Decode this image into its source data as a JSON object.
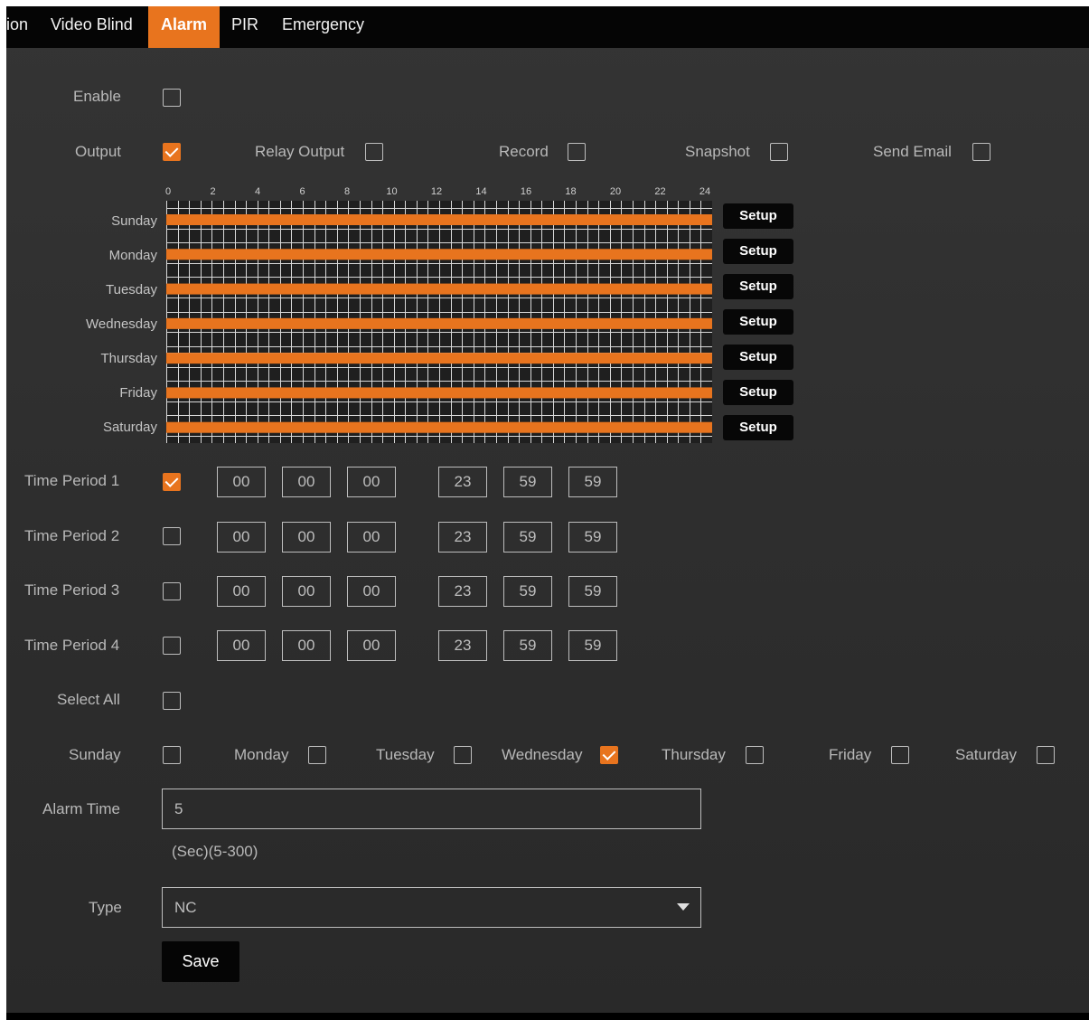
{
  "tabs": [
    "ion",
    "Video Blind",
    "Alarm",
    "PIR",
    "Emergency"
  ],
  "active_tab": "Alarm",
  "accent_color": "#e8741e",
  "enable": {
    "label": "Enable",
    "checked": false
  },
  "outputs": [
    {
      "label": "Output",
      "checked": true
    },
    {
      "label": "Relay Output",
      "checked": false
    },
    {
      "label": "Record",
      "checked": false
    },
    {
      "label": "Snapshot",
      "checked": false
    },
    {
      "label": "Send Email",
      "checked": false
    }
  ],
  "schedule": {
    "hour_labels": [
      "0",
      "2",
      "4",
      "6",
      "8",
      "10",
      "12",
      "14",
      "16",
      "18",
      "20",
      "22",
      "24"
    ],
    "days": [
      "Sunday",
      "Monday",
      "Tuesday",
      "Wednesday",
      "Thursday",
      "Friday",
      "Saturday"
    ],
    "setup_label": "Setup",
    "armed_ranges_hours": [
      [
        0,
        24
      ],
      [
        0,
        24
      ],
      [
        0,
        24
      ],
      [
        0,
        24
      ],
      [
        0,
        24
      ],
      [
        0,
        24
      ],
      [
        0,
        24
      ]
    ]
  },
  "time_periods": [
    {
      "label": "Time Period 1",
      "checked": true,
      "start": [
        "00",
        "00",
        "00"
      ],
      "end": [
        "23",
        "59",
        "59"
      ]
    },
    {
      "label": "Time Period 2",
      "checked": false,
      "start": [
        "00",
        "00",
        "00"
      ],
      "end": [
        "23",
        "59",
        "59"
      ]
    },
    {
      "label": "Time Period 3",
      "checked": false,
      "start": [
        "00",
        "00",
        "00"
      ],
      "end": [
        "23",
        "59",
        "59"
      ]
    },
    {
      "label": "Time Period 4",
      "checked": false,
      "start": [
        "00",
        "00",
        "00"
      ],
      "end": [
        "23",
        "59",
        "59"
      ]
    }
  ],
  "select_all": {
    "label": "Select All",
    "checked": false
  },
  "weekdays": [
    {
      "label": "Sunday",
      "checked": false
    },
    {
      "label": "Monday",
      "checked": false
    },
    {
      "label": "Tuesday",
      "checked": false
    },
    {
      "label": "Wednesday",
      "checked": true
    },
    {
      "label": "Thursday",
      "checked": false
    },
    {
      "label": "Friday",
      "checked": false
    },
    {
      "label": "Saturday",
      "checked": false
    }
  ],
  "alarm_time": {
    "label": "Alarm Time",
    "value": "5",
    "hint": "(Sec)(5-300)"
  },
  "type": {
    "label": "Type",
    "value": "NC",
    "icon": "caret-down-icon"
  },
  "save_label": "Save"
}
